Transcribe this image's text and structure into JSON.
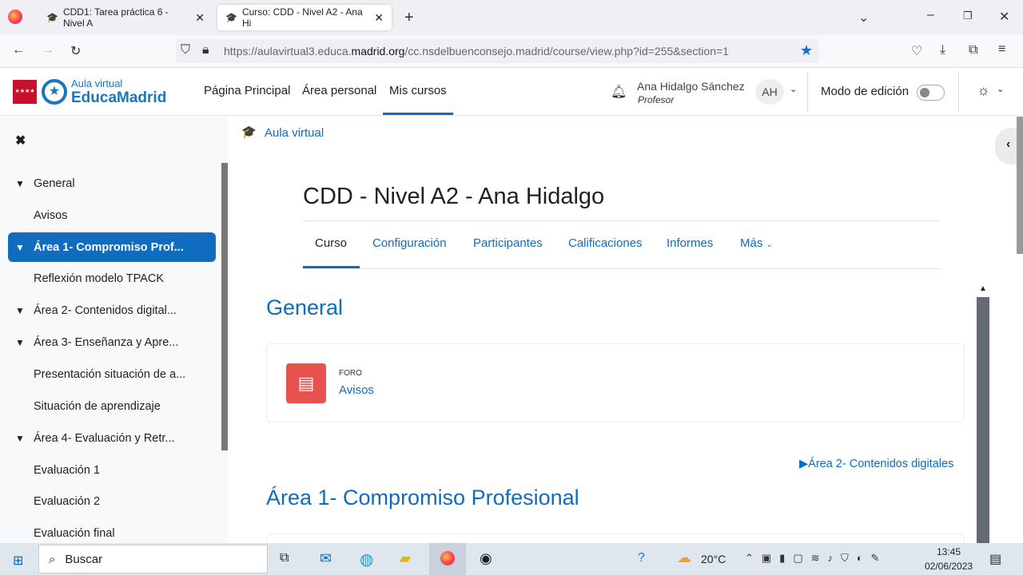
{
  "browser": {
    "tabs": [
      {
        "title": "CDD1: Tarea práctica 6 - Nivel A"
      },
      {
        "title": "Curso: CDD - Nivel A2 - Ana Hi"
      }
    ],
    "url_prefix": "https://aulavirtual3.educa.",
    "url_domain": "madrid.org",
    "url_rest": "/cc.nsdelbuenconsejo.madrid/course/view.php?id=255&section=1"
  },
  "header": {
    "logo_top": "Aula virtual",
    "logo_main": "EducaMadrid",
    "nav": [
      "Página Principal",
      "Área personal",
      "Mis cursos"
    ],
    "user_name": "Ana Hidalgo Sánchez",
    "user_role": "Profesor",
    "avatar": "AH",
    "edit_mode": "Modo de edición",
    "edit_mode_on": false
  },
  "drawer": {
    "items": [
      {
        "label": "General",
        "type": "section"
      },
      {
        "label": "Avisos",
        "type": "item"
      },
      {
        "label": "Área 1- Compromiso Prof...",
        "type": "section",
        "active": true
      },
      {
        "label": "Reflexión modelo TPACK",
        "type": "item"
      },
      {
        "label": "Área 2- Contenidos digital...",
        "type": "section"
      },
      {
        "label": "Área 3- Enseñanza y Apre...",
        "type": "section"
      },
      {
        "label": "Presentación situación de a...",
        "type": "item"
      },
      {
        "label": "Situación de aprendizaje",
        "type": "item"
      },
      {
        "label": "Área 4- Evaluación y Retr...",
        "type": "section"
      },
      {
        "label": "Evaluación 1",
        "type": "item"
      },
      {
        "label": "Evaluación 2",
        "type": "item"
      },
      {
        "label": "Evaluación final",
        "type": "item"
      }
    ]
  },
  "main": {
    "breadcrumb": "Aula virtual",
    "title": "CDD - Nivel A2 - Ana Hidalgo",
    "tabs": [
      "Curso",
      "Configuración",
      "Participantes",
      "Calificaciones",
      "Informes",
      "Más"
    ],
    "section1": "General",
    "activity_type": "FORO",
    "activity_name": "Avisos",
    "next_link": "▶Área 2- Contenidos digitales",
    "section2": "Área 1- Compromiso Profesional"
  },
  "taskbar": {
    "search": "Buscar",
    "temp": "20°C",
    "time": "13:45",
    "date": "02/06/2023"
  },
  "colors": {
    "accent": "#0f6cbf",
    "forum": "#e8524e"
  }
}
